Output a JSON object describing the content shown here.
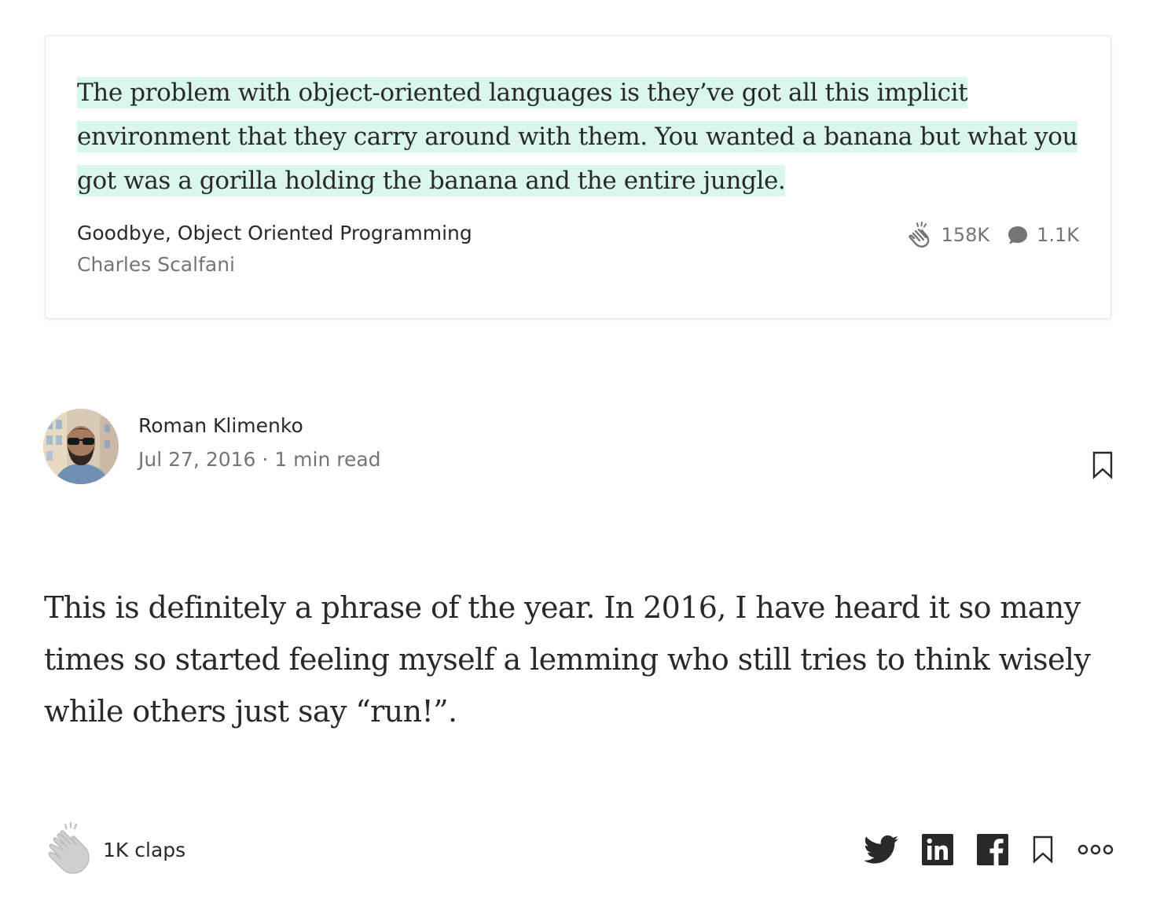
{
  "quote_card": {
    "quote": "The problem with object-oriented languages is they’ve got all this implicit environment that they carry around with them. You wanted a banana but what you got was a gorilla holding the banana and the entire jungle.",
    "source_title": "Goodbye, Object Oriented Programming",
    "source_author": "Charles Scalfani",
    "claps": "158K",
    "responses": "1.1K",
    "highlight_color": "#d9f7ec"
  },
  "post": {
    "author_name": "Roman Klimenko",
    "date": "Jul 27, 2016",
    "separator": "·",
    "read_time": "1 min read",
    "body": "This is definitely a phrase of the year. In 2016, I have heard it so many times so started feeling myself a lemming who still tries to think wisely while others just say “run!”."
  },
  "footer": {
    "claps_label": "1K claps",
    "actions": [
      "twitter-icon",
      "linkedin-icon",
      "facebook-icon",
      "bookmark-icon",
      "more-icon"
    ]
  },
  "colors": {
    "text": "#292929",
    "muted": "#757575",
    "icon_dark": "#292929",
    "clap_gray": "#bdbdbd"
  }
}
